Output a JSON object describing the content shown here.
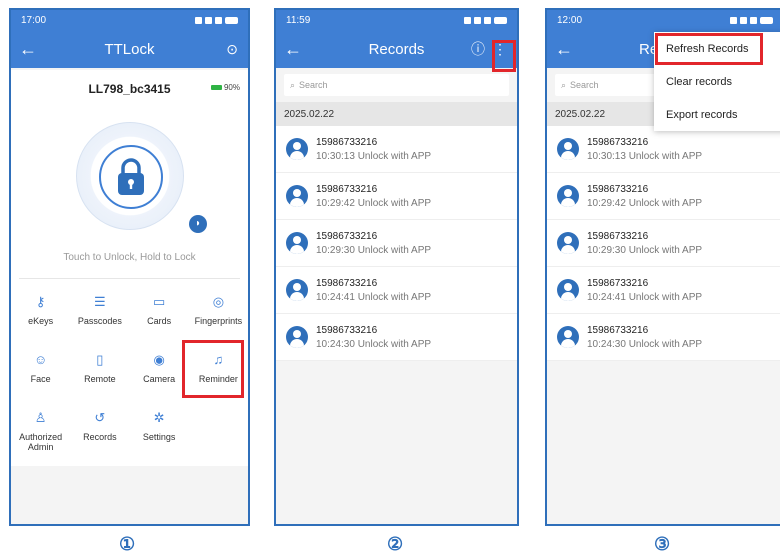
{
  "screen1": {
    "status_time": "17:00",
    "title": "TTLock",
    "lock_name": "LL798_bc3415",
    "battery": "90%",
    "touch_hint": "Touch to Unlock, Hold to Lock",
    "features": [
      {
        "label": "eKeys",
        "icon": "ekeys-icon"
      },
      {
        "label": "Passcodes",
        "icon": "passcodes-icon"
      },
      {
        "label": "Cards",
        "icon": "cards-icon"
      },
      {
        "label": "Fingerprints",
        "icon": "fingerprint-icon"
      },
      {
        "label": "Face",
        "icon": "face-icon"
      },
      {
        "label": "Remote",
        "icon": "remote-icon"
      },
      {
        "label": "Camera",
        "icon": "camera-icon"
      },
      {
        "label": "Reminder",
        "icon": "bell-icon"
      },
      {
        "label": "Authorized Admin",
        "icon": "admin-icon"
      },
      {
        "label": "Records",
        "icon": "records-icon"
      },
      {
        "label": "Settings",
        "icon": "settings-icon"
      }
    ]
  },
  "screen2": {
    "status_time": "11:59",
    "title": "Records",
    "search_placeholder": "Search",
    "date": "2025.02.22",
    "records": [
      {
        "phone": "15986733216",
        "text": "10:30:13 Unlock with APP"
      },
      {
        "phone": "15986733216",
        "text": "10:29:42 Unlock with APP"
      },
      {
        "phone": "15986733216",
        "text": "10:29:30 Unlock with APP"
      },
      {
        "phone": "15986733216",
        "text": "10:24:41 Unlock with APP"
      },
      {
        "phone": "15986733216",
        "text": "10:24:30 Unlock with APP"
      }
    ]
  },
  "screen3": {
    "status_time": "12:00",
    "title_partial": "Re",
    "search_placeholder": "Search",
    "date": "2025.02.22",
    "menu": [
      "Refresh Records",
      "Clear records",
      "Export records"
    ],
    "records": [
      {
        "phone": "15986733216",
        "text": "10:30:13 Unlock with APP"
      },
      {
        "phone": "15986733216",
        "text": "10:29:42 Unlock with APP"
      },
      {
        "phone": "15986733216",
        "text": "10:29:30 Unlock with APP"
      },
      {
        "phone": "15986733216",
        "text": "10:24:41 Unlock with APP"
      },
      {
        "phone": "15986733216",
        "text": "10:24:30 Unlock with APP"
      }
    ]
  },
  "steps": [
    "①",
    "②",
    "③"
  ],
  "colors": {
    "header": "#3f7fd4",
    "highlight": "#e2262b",
    "step": "#2f6fba"
  }
}
